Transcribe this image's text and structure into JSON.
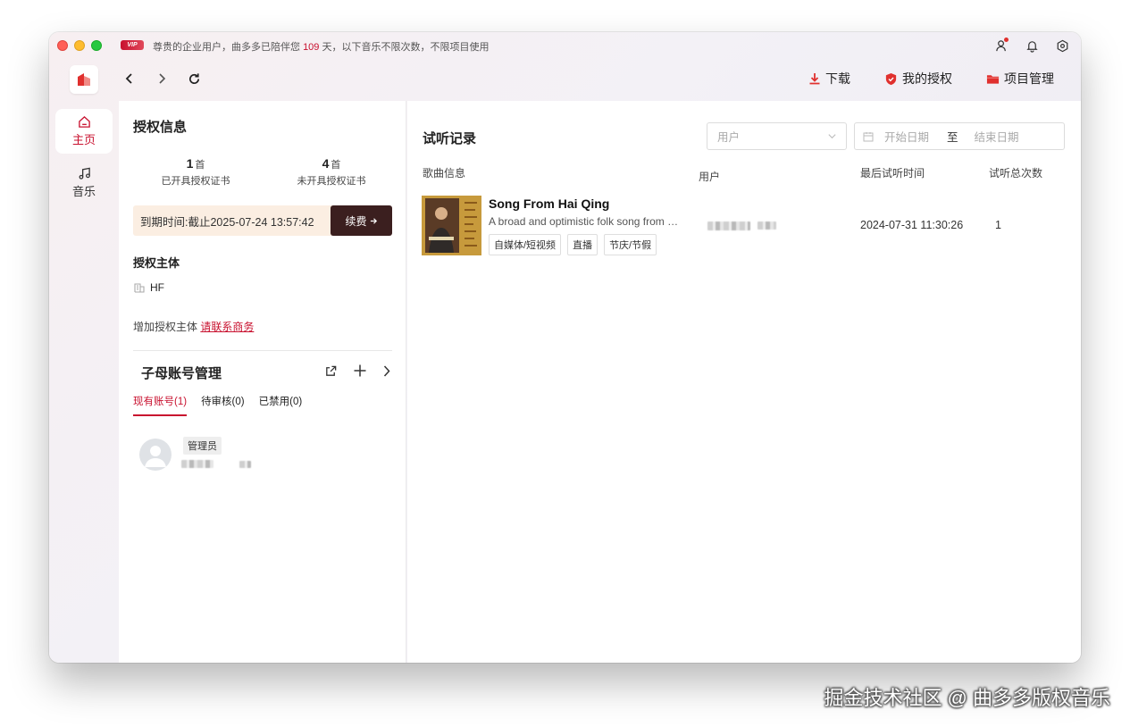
{
  "titlebar": {
    "vip_badge": "VIP",
    "notice_before": "尊贵的企业用户，曲多多已陪伴您 ",
    "notice_days": "109",
    "notice_after": " 天，以下音乐不限次数，不限项目使用"
  },
  "toolbar": {
    "download": "下载",
    "my_license": "我的授权",
    "project_mgmt": "项目管理"
  },
  "sidebar": {
    "items": [
      {
        "label": "主页",
        "icon": "home-icon",
        "active": true
      },
      {
        "label": "音乐",
        "icon": "music-note-icon",
        "active": false
      }
    ]
  },
  "license_info": {
    "title": "授权信息",
    "issued_count": "1",
    "issued_unit": "首",
    "issued_label": "已开具授权证书",
    "pending_count": "4",
    "pending_unit": "首",
    "pending_label": "未开具授权证书",
    "expiry": "到期时间:截止2025-07-24 13:57:42",
    "renew_label": "续费",
    "entity_title": "授权主体",
    "entity_name": "HF",
    "add_entity_text": "增加授权主体 ",
    "add_entity_link": "请联系商务"
  },
  "accounts": {
    "title": "子母账号管理",
    "tabs": [
      {
        "label": "现有账号(1)",
        "active": true
      },
      {
        "label": "待审核(0)",
        "active": false
      },
      {
        "label": "已禁用(0)",
        "active": false
      }
    ],
    "member_role": "管理员"
  },
  "history": {
    "title": "试听记录",
    "user_filter_placeholder": "用户",
    "start_date_placeholder": "开始日期",
    "range_separator": "至",
    "end_date_placeholder": "结束日期",
    "columns": [
      "歌曲信息",
      "用户",
      "最后试听时间",
      "试听总次数"
    ],
    "rows": [
      {
        "title": "Song From Hai Qing",
        "description": "A broad and optimistic folk song from the grasslands",
        "tags": [
          "自媒体/短视频",
          "直播",
          "节庆/节假"
        ],
        "last_time": "2024-07-31 11:30:26",
        "count": "1"
      }
    ]
  },
  "watermark": "掘金技术社区 @ 曲多多版权音乐",
  "colors": {
    "accent": "#c8102e",
    "renew_bg": "#3b1f1f",
    "expiry_bg": "#fbeee2"
  }
}
